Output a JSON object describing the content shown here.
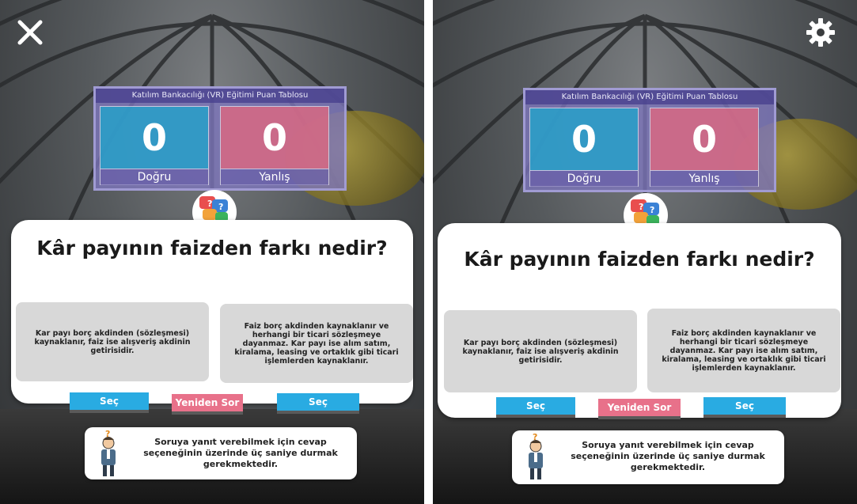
{
  "panes": [
    {
      "id": "left",
      "control_icon": "close-icon",
      "board_title": "Katılım Bankacılığı (VR) Eğitimi Puan Tablosu",
      "correct_count": "0",
      "correct_label": "Doğru",
      "wrong_count": "0",
      "wrong_label": "Yanlış",
      "question": "Kâr payının faizden farkı nedir?",
      "option_a": "Kar payı borç akdinden (sözleşmesi) kaynaklanır, faiz ise alışveriş akdinin getirisidir.",
      "option_b": "Faiz borç akdinden kaynaklanır ve herhangi bir ticari sözleşmeye dayanmaz. Kar payı ise alım satım, kiralama, leasing ve ortaklık gibi ticari işlemlerden kaynaklanır.",
      "select_a_label": "Seç",
      "reask_label": "Yeniden Sor",
      "select_b_label": "Seç",
      "hint": "Soruya yanıt verebilmek için cevap seçeneğinin üzerinde üç saniye durmak gerekmektedir."
    },
    {
      "id": "right",
      "control_icon": "gear-icon",
      "board_title": "Katılım Bankacılığı (VR) Eğitimi Puan Tablosu",
      "correct_count": "0",
      "correct_label": "Doğru",
      "wrong_count": "0",
      "wrong_label": "Yanlış",
      "question": "Kâr payının faizden farkı nedir?",
      "option_a": "Kar payı borç akdinden (sözleşmesi) kaynaklanır, faiz ise alışveriş akdinin getirisidir.",
      "option_b": "Faiz borç akdinden kaynaklanır ve herhangi bir ticari sözleşmeye dayanmaz. Kar payı ise alım satım, kiralama, leasing ve ortaklık gibi ticari işlemlerden kaynaklanır.",
      "select_a_label": "Seç",
      "reask_label": "Yeniden Sor",
      "select_b_label": "Seç",
      "hint": "Soruya yanıt verebilmek için cevap seçeneğinin üzerinde üç saniye durmak gerekmektedir."
    }
  ],
  "colors": {
    "correct": "#27a0c9",
    "wrong": "#d86882",
    "board": "#7e76be",
    "select_button": "#29abe2",
    "reask_button": "#e8718a"
  }
}
